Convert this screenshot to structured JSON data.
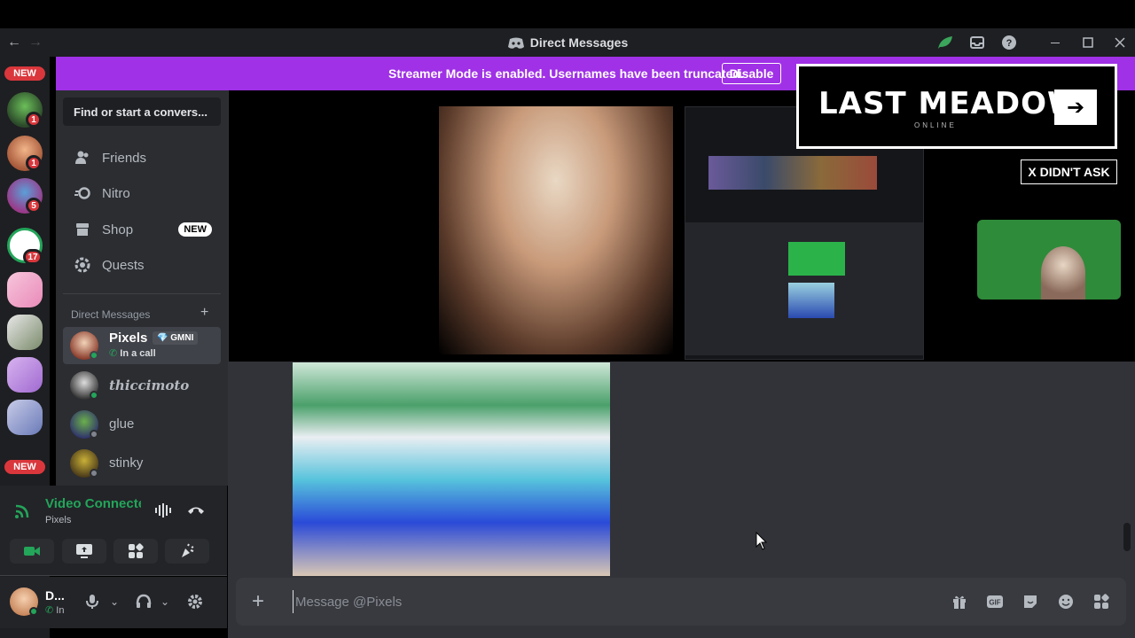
{
  "window": {
    "title": "Direct Messages",
    "controls": [
      "back-icon",
      "forward-icon",
      "leaf-icon",
      "inbox-icon",
      "help-icon",
      "minimize-icon",
      "maximize-icon",
      "close-icon"
    ]
  },
  "banner": {
    "message": "Streamer Mode is enabled. Usernames have been truncated.",
    "disable_label": "Disable",
    "color": "#a031e6"
  },
  "guilds": {
    "new_top": "NEW",
    "new_bottom": "NEW",
    "mention_counts": [
      "1",
      "1",
      "5",
      "17"
    ]
  },
  "sidebar": {
    "search_placeholder": "Find or start a convers...",
    "nav": [
      {
        "label": "Friends",
        "icon": "friends-icon"
      },
      {
        "label": "Nitro",
        "icon": "nitro-icon"
      },
      {
        "label": "Shop",
        "icon": "shop-icon",
        "badge": "NEW"
      },
      {
        "label": "Quests",
        "icon": "quests-icon"
      }
    ],
    "dm_header": "Direct Messages",
    "dms": [
      {
        "name": "Pixels",
        "tag": "GMNI",
        "status": "In a call",
        "active": true
      },
      {
        "name": "thiccimoto"
      },
      {
        "name": "glue"
      },
      {
        "name": "stinky"
      }
    ]
  },
  "voice": {
    "status": "Video Connected",
    "channel": "Pixels"
  },
  "user_panel": {
    "name": "D...",
    "status": "In"
  },
  "overlays": {
    "last_meadow": "LAST MEADOW",
    "last_meadow_sub": "ONLINE",
    "x_didnt_ask": "X DIDN'T ASK"
  },
  "composer": {
    "placeholder": "Message @Pixels"
  },
  "colors": {
    "accent_green": "#23a55a",
    "danger_red": "#da373c"
  }
}
